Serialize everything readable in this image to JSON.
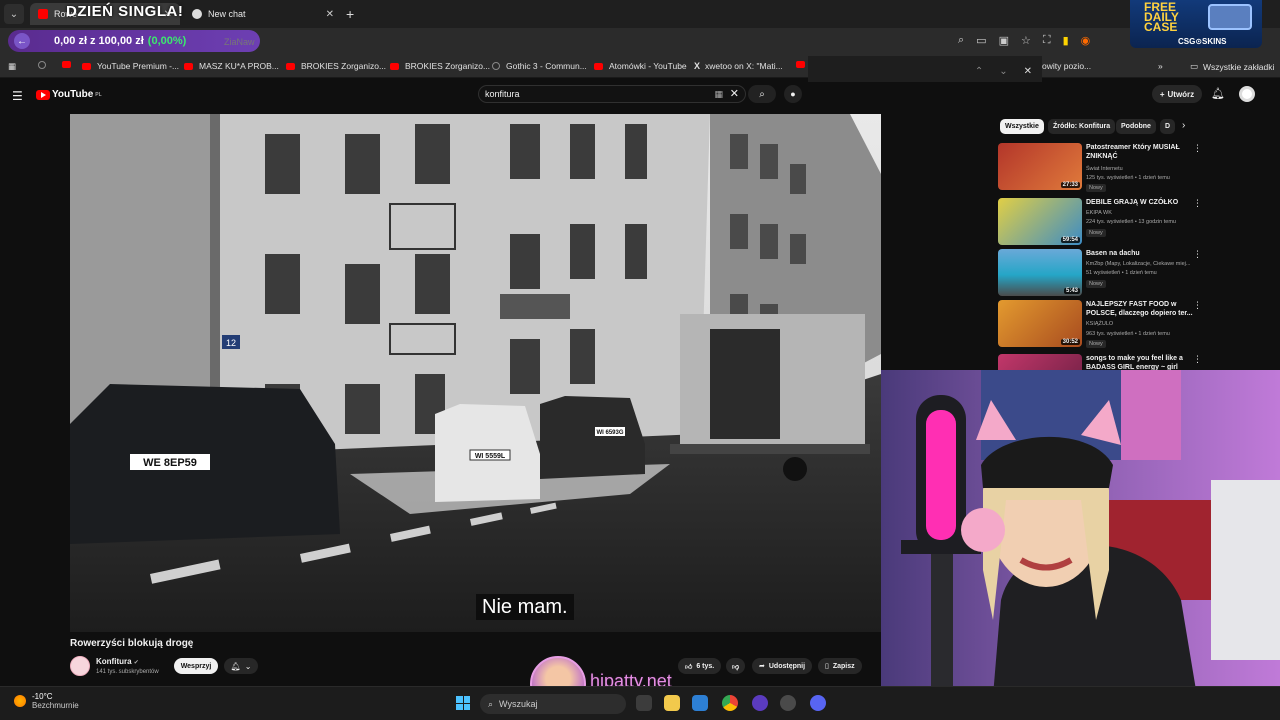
{
  "browser": {
    "tabs": [
      {
        "label": "Rowe",
        "active": true
      },
      {
        "label": "New chat",
        "active": false
      }
    ],
    "promo_text": "DZIEŃ SINGLA!",
    "bet_widget": {
      "balance": "0,00 zł",
      "separator": "z",
      "total": "100,00 zł",
      "percent": "(0,00%)"
    },
    "url_fragment": "ZiaNaw",
    "bookmarks": [
      {
        "label": "YouTube Premium -...",
        "icon": "youtube"
      },
      {
        "label": "MASZ KU*A PROB...",
        "icon": "youtube"
      },
      {
        "label": "BROKIES Zorganizo...",
        "icon": "youtube"
      },
      {
        "label": "BROKIES Zorganizo...",
        "icon": "youtube"
      },
      {
        "label": "Gothic 3 - Commun...",
        "icon": "globe"
      },
      {
        "label": "Atomówki - YouTube",
        "icon": "youtube"
      },
      {
        "label": "xwetoo on X: \"Mati...",
        "icon": "x"
      },
      {
        "label": "owity pozio...",
        "icon": "none"
      }
    ],
    "all_bookmarks_label": "Wszystkie zakładki"
  },
  "csgo_overlay": {
    "line1": "FREE",
    "line2": "DAILY",
    "line3": "CASE",
    "brand": "CSG⊙SKINS"
  },
  "youtube": {
    "logo_text": "YouTube",
    "region": "PL",
    "search_value": "konfitura",
    "create_label": "Utwórz",
    "video": {
      "subtitle": "Nie mam.",
      "title": "Rowerzyści blokują drogę",
      "channel": "Konfitura",
      "subscribers": "141 tys. subskrybentów",
      "support_label": "Wesprzyj",
      "likes": "6 tys.",
      "share_label": "Udostępnij",
      "save_label": "Zapisz",
      "plates": [
        "WE 8EP59",
        "WI 5559L",
        "WI 6593G"
      ],
      "building_number": "12"
    },
    "chips": [
      "Wszystkie",
      "Źródło: Konfitura",
      "Podobne",
      "D"
    ],
    "recommendations": [
      {
        "title": "Patostreamer Który MUSIAŁ ZNIKNĄĆ",
        "channel": "Świat Internetu",
        "views": "125 tys. wyświetleń • 1 dzień temu",
        "badge": "Nowy",
        "duration": "27:33",
        "thumb_color": "#a3402f"
      },
      {
        "title": "DEBILE GRAJĄ W CZÓŁKO",
        "channel": "EKIPA WK",
        "views": "224 tys. wyświetleń • 13 godzin temu",
        "badge": "Nowy",
        "duration": "59:54",
        "thumb_color": "#d8c43a"
      },
      {
        "title": "Basen na dachu",
        "channel": "Km2bp (Mapy, Lokalizacje, Ciekawe miej...",
        "views": "51 wyświetleń • 1 dzień temu",
        "badge": "Nowy",
        "duration": "5:43",
        "thumb_color": "#2f8fbf"
      },
      {
        "title": "NAJLEPSZY FAST FOOD w POLSCE, dlaczego dopiero ter...",
        "channel": "KSIĄŻULO",
        "views": "963 tys. wyświetleń • 1 dzień temu",
        "badge": "Nowy",
        "duration": "30:52",
        "thumb_color": "#e0862a"
      },
      {
        "title": "songs to make you feel like a BADASS GIRL energy ~ girl",
        "channel": "",
        "views": "",
        "badge": "",
        "duration": "",
        "thumb_color": "#c2376a"
      }
    ]
  },
  "stream": {
    "brand": "hipatty.net"
  },
  "taskbar": {
    "temperature": "-10°C",
    "condition": "Bezchmurnie",
    "search_placeholder": "Wyszukaj"
  }
}
